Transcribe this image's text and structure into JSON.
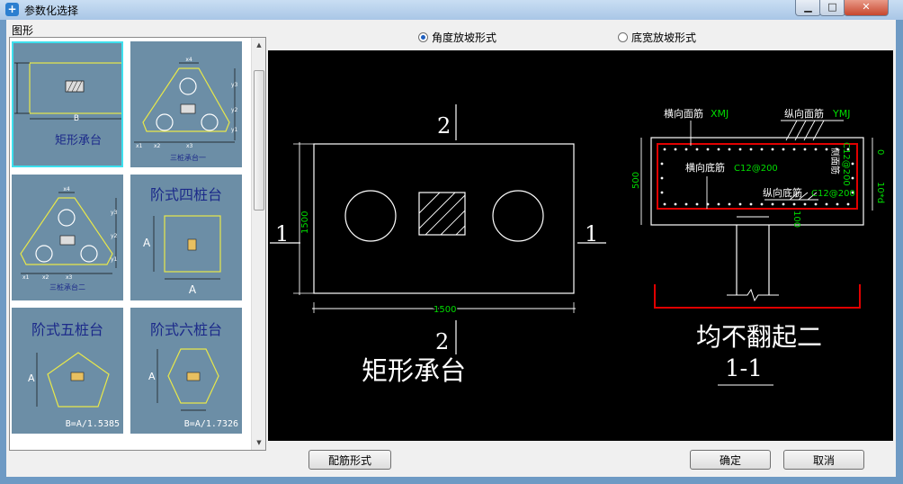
{
  "window": {
    "title": "参数化选择",
    "icon": "app-logo-icon",
    "controls": [
      "minimize-icon",
      "maximize-icon",
      "close-icon"
    ]
  },
  "left": {
    "group_label": "图形",
    "thumbnails": [
      {
        "label": "矩形承台",
        "dim": "B",
        "selected": true
      },
      {
        "label": "三桩承台一",
        "dims": [
          "x4",
          "y3",
          "y2",
          "y1",
          "x1",
          "x2",
          "x3"
        ]
      },
      {
        "label": "三桩承台二",
        "dims": [
          "x4",
          "y3",
          "y2",
          "y1",
          "x1",
          "x2",
          "x3"
        ]
      },
      {
        "label": "阶式四桩台",
        "dims": [
          "A",
          "A"
        ]
      },
      {
        "label": "阶式五桩台",
        "dims": [
          "A",
          "B=A/1.5385"
        ]
      },
      {
        "label": "阶式六桩台",
        "dims": [
          "A",
          "B=A/1.7326"
        ]
      }
    ]
  },
  "options": {
    "radio_angle": "角度放坡形式",
    "radio_width": "底宽放坡形式",
    "selected": "angle"
  },
  "preview": {
    "plan": {
      "section_mark_top": "2",
      "section_mark_bottom": "2",
      "section_mark_left": "1",
      "section_mark_right": "1",
      "dim_height": "1500",
      "dim_width": "1500",
      "caption": "矩形承台"
    },
    "section": {
      "label_top_transverse": "横向面筋",
      "code_top_transverse": "XMJ",
      "label_top_longitudinal": "纵向面筋",
      "code_top_longitudinal": "YMJ",
      "label_side": "侧面筋",
      "code_side": "C12@200",
      "label_bottom_transverse": "横向底筋",
      "code_bottom_transverse": "C12@200",
      "label_bottom_longitudinal": "纵向底筋",
      "code_bottom_longitudinal": "C12@200",
      "dim_height": "500",
      "dim_zero": "0",
      "dim_anchor": "10*d",
      "dim_100": "100",
      "caption": "均不翻起二",
      "section_name": "1-1"
    },
    "colors": {
      "line": "#ffffff",
      "rebar": "#e00000",
      "dim_text": "#00dd00"
    }
  },
  "buttons": {
    "rebar_form": "配筋形式",
    "ok": "确定",
    "cancel": "取消"
  }
}
